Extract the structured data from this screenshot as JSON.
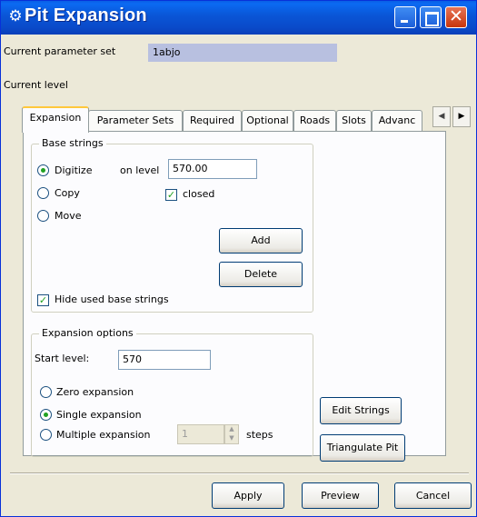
{
  "window": {
    "title": "Pit Expansion",
    "app_icon": "gear-icon",
    "controls": {
      "minimize": "minimize-icon",
      "maximize": "maximize-icon",
      "close": "✕"
    }
  },
  "header": {
    "param_set_label": "Current parameter set",
    "param_set_value": "1abjo",
    "current_level_label": "Current level"
  },
  "tabs": [
    {
      "label": "Expansion",
      "active": true
    },
    {
      "label": "Parameter Sets"
    },
    {
      "label": "Required"
    },
    {
      "label": "Optional"
    },
    {
      "label": "Roads"
    },
    {
      "label": "Slots"
    },
    {
      "label": "Advanc"
    }
  ],
  "tab_scroll": {
    "left": "◀",
    "right": "▶"
  },
  "base_strings": {
    "title": "Base strings",
    "digitize_label": "Digitize",
    "copy_label": "Copy",
    "move_label": "Move",
    "on_level_label": "on level",
    "on_level_value": "570.00",
    "closed_label": "closed",
    "closed_checked": true,
    "selected_mode": "Digitize",
    "add_label": "Add",
    "delete_label": "Delete",
    "hide_used_label": "Hide used base strings",
    "hide_used_checked": true
  },
  "expansion_options": {
    "title": "Expansion options",
    "start_level_label": "Start level:",
    "start_level_value": "570",
    "zero_label": "Zero expansion",
    "single_label": "Single expansion",
    "multiple_label": "Multiple expansion",
    "selected": "Single expansion",
    "steps_value": "1",
    "steps_label": "steps"
  },
  "side_buttons": {
    "edit_strings": "Edit Strings",
    "triangulate_pit": "Triangulate Pit"
  },
  "footer": {
    "apply": "Apply",
    "preview": "Preview",
    "cancel": "Cancel"
  },
  "colors": {
    "title_bar": "#0a55d6",
    "readonly_field": "#b8c0e0",
    "selected_indicator": "#21a121"
  }
}
